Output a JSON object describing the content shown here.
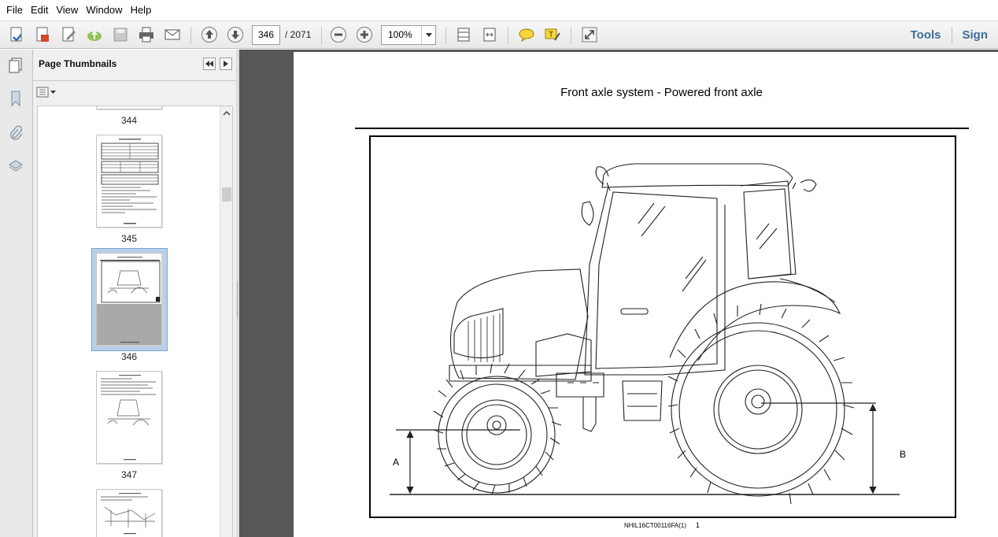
{
  "menu": [
    "File",
    "Edit",
    "View",
    "Window",
    "Help"
  ],
  "toolbar": {
    "current_page": "346",
    "page_total": "/ 2071",
    "zoom": "100%",
    "tools_label": "Tools",
    "sign_label": "Sign"
  },
  "panel": {
    "title": "Page Thumbnails",
    "thumbnails": [
      {
        "label": "344"
      },
      {
        "label": "345"
      },
      {
        "label": "346"
      },
      {
        "label": "347"
      }
    ]
  },
  "document": {
    "title": "Front axle system - Powered front axle",
    "figure": {
      "label_a": "A",
      "label_b": "B",
      "caption": "NHIL16CT00116FA(1)",
      "caption_number": "1"
    }
  },
  "colors": {
    "accent_link": "#3f6d9a",
    "doc_background": "#575757",
    "selected_thumb": "#b8d0e8"
  }
}
